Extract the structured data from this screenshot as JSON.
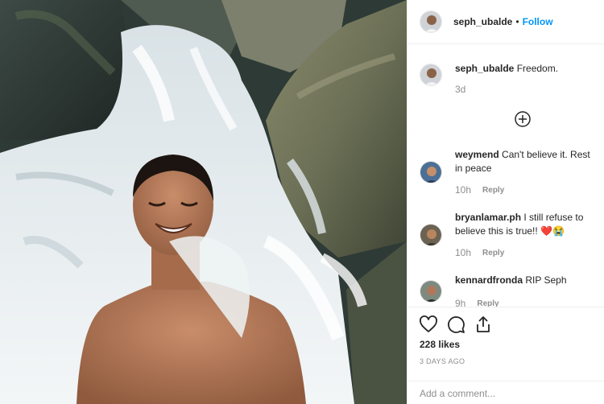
{
  "post": {
    "username": "seph_ubalde",
    "follow_label": "Follow",
    "separator": "•",
    "caption": {
      "username": "seph_ubalde",
      "text": "Freedom.",
      "time": "3d"
    },
    "comments": [
      {
        "username": "weymend",
        "text": "Can't believe it. Rest in peace",
        "time": "10h",
        "reply_label": "Reply"
      },
      {
        "username": "bryanlamar.ph",
        "text": "I still refuse to believe this is true!! ❤️😭",
        "time": "10h",
        "reply_label": "Reply"
      },
      {
        "username": "kennardfronda",
        "text": "RIP Seph",
        "time": "9h",
        "reply_label": "Reply"
      }
    ],
    "likes": "228 likes",
    "date": "3 DAYS AGO",
    "add_comment_placeholder": "Add a comment..."
  },
  "colors": {
    "link_blue": "#0095f6",
    "text": "#262626",
    "muted": "#8e8e8e",
    "heart_red": "#ed4956"
  },
  "icons": [
    "heart-icon",
    "comment-icon",
    "share-icon",
    "plus-circle-icon"
  ]
}
